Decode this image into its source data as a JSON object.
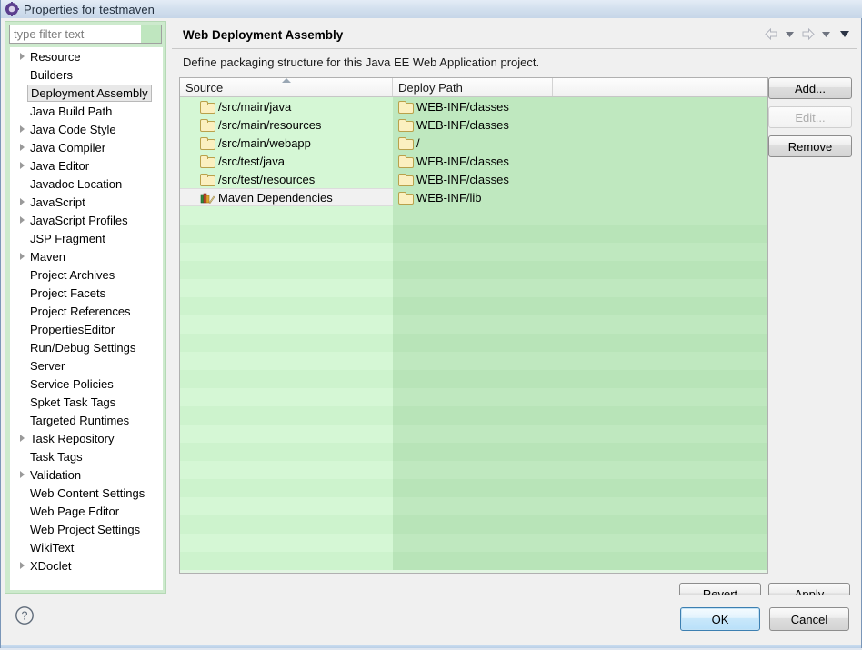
{
  "window": {
    "title": "Properties for testmaven",
    "icon": "eclipse-properties-icon"
  },
  "sidebar": {
    "filter": {
      "placeholder": "type filter text",
      "value": ""
    },
    "items": [
      {
        "label": "Resource",
        "expandable": true,
        "selected": false
      },
      {
        "label": "Builders",
        "expandable": false,
        "selected": false
      },
      {
        "label": "Deployment Assembly",
        "expandable": false,
        "selected": true
      },
      {
        "label": "Java Build Path",
        "expandable": false,
        "selected": false
      },
      {
        "label": "Java Code Style",
        "expandable": true,
        "selected": false
      },
      {
        "label": "Java Compiler",
        "expandable": true,
        "selected": false
      },
      {
        "label": "Java Editor",
        "expandable": true,
        "selected": false
      },
      {
        "label": "Javadoc Location",
        "expandable": false,
        "selected": false
      },
      {
        "label": "JavaScript",
        "expandable": true,
        "selected": false
      },
      {
        "label": "JavaScript Profiles",
        "expandable": true,
        "selected": false
      },
      {
        "label": "JSP Fragment",
        "expandable": false,
        "selected": false
      },
      {
        "label": "Maven",
        "expandable": true,
        "selected": false
      },
      {
        "label": "Project Archives",
        "expandable": false,
        "selected": false
      },
      {
        "label": "Project Facets",
        "expandable": false,
        "selected": false
      },
      {
        "label": "Project References",
        "expandable": false,
        "selected": false
      },
      {
        "label": "PropertiesEditor",
        "expandable": false,
        "selected": false
      },
      {
        "label": "Run/Debug Settings",
        "expandable": false,
        "selected": false
      },
      {
        "label": "Server",
        "expandable": false,
        "selected": false
      },
      {
        "label": "Service Policies",
        "expandable": false,
        "selected": false
      },
      {
        "label": "Spket Task Tags",
        "expandable": false,
        "selected": false
      },
      {
        "label": "Targeted Runtimes",
        "expandable": false,
        "selected": false
      },
      {
        "label": "Task Repository",
        "expandable": true,
        "selected": false
      },
      {
        "label": "Task Tags",
        "expandable": false,
        "selected": false
      },
      {
        "label": "Validation",
        "expandable": true,
        "selected": false
      },
      {
        "label": "Web Content Settings",
        "expandable": false,
        "selected": false
      },
      {
        "label": "Web Page Editor",
        "expandable": false,
        "selected": false
      },
      {
        "label": "Web Project Settings",
        "expandable": false,
        "selected": false
      },
      {
        "label": "WikiText",
        "expandable": false,
        "selected": false
      },
      {
        "label": "XDoclet",
        "expandable": true,
        "selected": false
      }
    ]
  },
  "page": {
    "title": "Web Deployment Assembly",
    "description": "Define packaging structure for this Java EE Web Application project.",
    "nav": {
      "back": "back-arrow-icon",
      "back_menu": "chevron-down-icon",
      "forward": "forward-arrow-icon",
      "forward_menu": "chevron-down-icon",
      "view_menu": "chevron-down-icon"
    }
  },
  "table": {
    "columns": [
      "Source",
      "Deploy Path",
      ""
    ],
    "sort_column": "Source",
    "sort_direction": "ascending",
    "rows": [
      {
        "source": "/src/main/java",
        "deploy": "WEB-INF/classes",
        "source_icon": "folder-icon",
        "deploy_icon": "folder-icon",
        "selected": false
      },
      {
        "source": "/src/main/resources",
        "deploy": "WEB-INF/classes",
        "source_icon": "folder-icon",
        "deploy_icon": "folder-icon",
        "selected": false
      },
      {
        "source": "/src/main/webapp",
        "deploy": "/",
        "source_icon": "folder-icon",
        "deploy_icon": "folder-icon",
        "selected": false
      },
      {
        "source": "/src/test/java",
        "deploy": "WEB-INF/classes",
        "source_icon": "folder-icon",
        "deploy_icon": "folder-icon",
        "selected": false
      },
      {
        "source": "/src/test/resources",
        "deploy": "WEB-INF/classes",
        "source_icon": "folder-icon",
        "deploy_icon": "folder-icon",
        "selected": false
      },
      {
        "source": "Maven Dependencies",
        "deploy": "WEB-INF/lib",
        "source_icon": "books-icon",
        "deploy_icon": "folder-icon",
        "selected": true
      }
    ],
    "empty_row_count": 20
  },
  "buttons": {
    "add": "Add...",
    "edit": "Edit...",
    "edit_enabled": false,
    "remove": "Remove",
    "revert": "Revert",
    "apply": "Apply",
    "ok": "OK",
    "cancel": "Cancel",
    "help": "help-icon"
  },
  "colors": {
    "table_row_light": "#d5f7d5",
    "table_row_dark": "#bfe8bf",
    "sidebar_frame": "#cdeacd",
    "ok_accent": "#3c7fb1",
    "folder_fill": "#fbf0c0"
  }
}
